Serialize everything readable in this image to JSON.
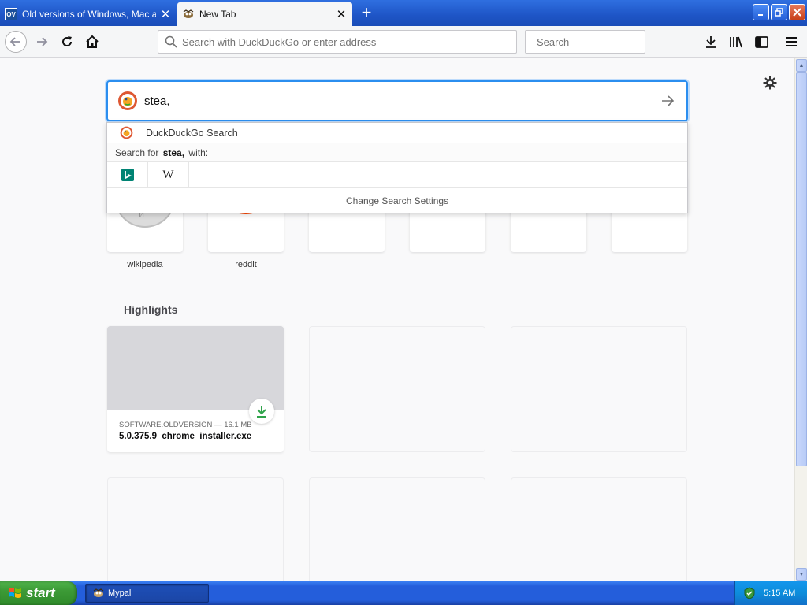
{
  "browser": {
    "tabs": [
      {
        "title": "Old versions of Windows, Mac and",
        "icon": "oldversion-icon",
        "icon_text": "OV",
        "active": false
      },
      {
        "title": "New Tab",
        "icon": "mypal-icon",
        "active": true
      }
    ],
    "urlbar_placeholder": "Search with DuckDuckGo or enter address",
    "searchbar_placeholder": "Search"
  },
  "newtab": {
    "search_query": "stea,",
    "suggestions": {
      "engine_row": "DuckDuckGo Search",
      "search_for_prefix": "Search for",
      "search_for_term": "stea,",
      "search_for_suffix": "with:",
      "engines": [
        "bing-icon",
        "wikipedia-icon"
      ],
      "wikipedia_glyph": "W",
      "change_settings": "Change Search Settings"
    },
    "top_sites": [
      {
        "label": "wikipedia",
        "icon": "wikipedia-globe-icon"
      },
      {
        "label": "reddit",
        "icon": "reddit-icon"
      },
      {
        "label": ""
      },
      {
        "label": ""
      },
      {
        "label": ""
      },
      {
        "label": ""
      }
    ],
    "highlights_title": "Highlights",
    "highlights": [
      {
        "source": "SOFTWARE.OLDVERSION — 16.1 MB",
        "title": "5.0.375.9_chrome_installer.exe",
        "badge_icon": "download-icon"
      }
    ]
  },
  "taskbar": {
    "start_label": "start",
    "window_label": "Mypal",
    "clock": "5:15 AM"
  },
  "colors": {
    "accent": "#0a84ff",
    "titlebar": "#2660d8",
    "reddit": "#ff4500",
    "download_green": "#2fa34a",
    "bing": "#008373"
  }
}
